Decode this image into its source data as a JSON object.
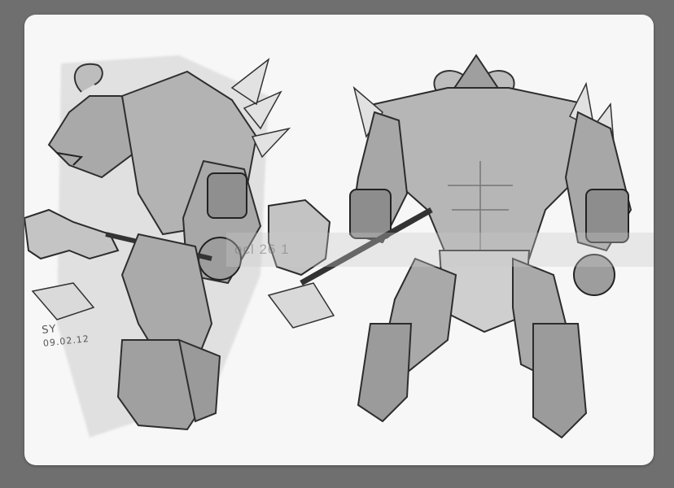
{
  "artwork": {
    "signature": "SY",
    "date": "09.02.12",
    "watermark": "ocl          26                1"
  },
  "colors": {
    "background": "#6f6f6f",
    "paper": "#f7f7f7",
    "ink": "#3a3a3a",
    "wash": "#c9c9c9"
  }
}
